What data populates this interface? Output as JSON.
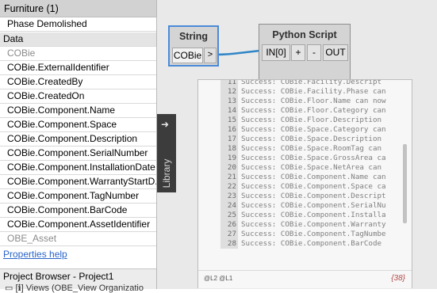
{
  "properties": {
    "header": "Furniture (1)",
    "phase_demolished": "Phase Demolished",
    "section": "Data",
    "params": [
      "COBie",
      "COBie.ExternalIdentifier",
      "COBie.CreatedBy",
      "COBie.CreatedOn",
      "COBie.Component.Name",
      "COBie.Component.Space",
      "COBie.Component.Description",
      "COBie.Component.SerialNumber",
      "COBie.Component.InstallationDate",
      "COBie.Component.WarrantyStartD...",
      "COBie.Component.TagNumber",
      "COBie.Component.BarCode",
      "COBie.Component.AssetIdentifier",
      "OBE_Asset"
    ],
    "help_link": "Properties help",
    "project_browser": "Project Browser - Project1",
    "tree_peek": "▭ [ℹ] Views (OBE_View Organizatio"
  },
  "library": {
    "label": "Library",
    "arrow": "➜"
  },
  "string_node": {
    "title": "String",
    "value": "COBie",
    "port": ">"
  },
  "python_node": {
    "title": "Python Script",
    "input": "IN[0]",
    "plus": "+",
    "minus": "-",
    "output": "OUT"
  },
  "output": {
    "lines": [
      {
        "num": "11",
        "text": "Success: COBie.Facility.Descript"
      },
      {
        "num": "12",
        "text": "Success: COBie.Facility.Phase can"
      },
      {
        "num": "13",
        "text": "Success: COBie.Floor.Name can now"
      },
      {
        "num": "14",
        "text": "Success: COBie.Floor.Category can"
      },
      {
        "num": "15",
        "text": "Success: COBie.Floor.Description"
      },
      {
        "num": "16",
        "text": "Success: COBie.Space.Category can"
      },
      {
        "num": "17",
        "text": "Success: COBie.Space.Description"
      },
      {
        "num": "18",
        "text": "Success: COBie.Space.RoomTag can"
      },
      {
        "num": "19",
        "text": "Success: COBie.Space.GrossArea ca"
      },
      {
        "num": "20",
        "text": "Success: COBie.Space.NetArea can"
      },
      {
        "num": "21",
        "text": "Success: COBie.Component.Name can"
      },
      {
        "num": "22",
        "text": "Success: COBie.Component.Space ca"
      },
      {
        "num": "23",
        "text": "Success: COBie.Component.Descript"
      },
      {
        "num": "24",
        "text": "Success: COBie.Component.SerialNu"
      },
      {
        "num": "25",
        "text": "Success: COBie.Component.Installa"
      },
      {
        "num": "26",
        "text": "Success: COBie.Component.Warranty"
      },
      {
        "num": "27",
        "text": "Success: COBie.Component.TagNumbe"
      },
      {
        "num": "28",
        "text": "Success: COBie.Component.BarCode"
      }
    ],
    "level_label": "@L2 @L1",
    "count": "{38}"
  },
  "colors": {
    "selection_blue": "#4b8ad8",
    "wire_blue": "#2f86c8",
    "library_tab": "#3c3c3c"
  }
}
